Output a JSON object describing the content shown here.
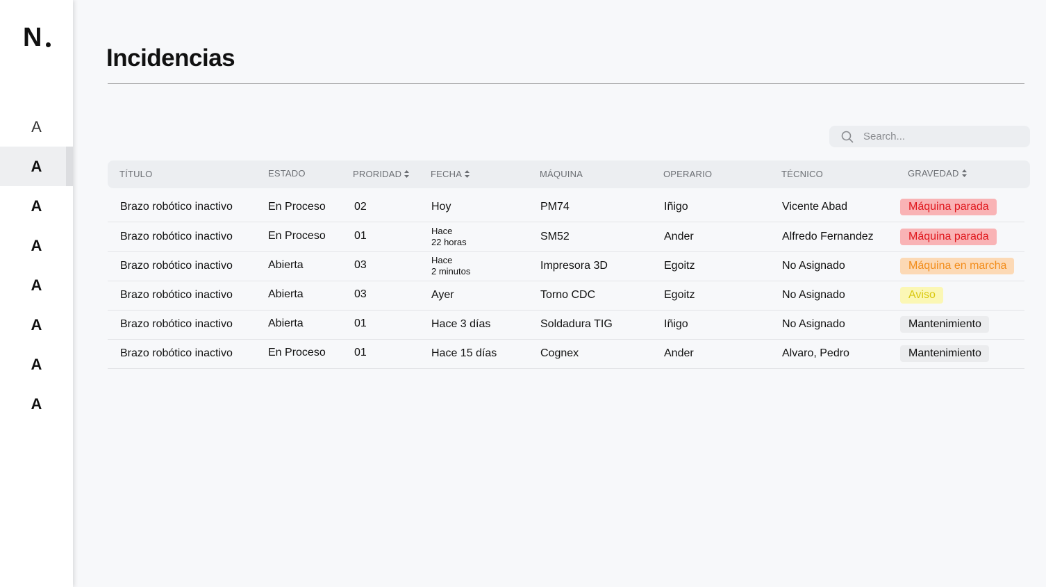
{
  "logo": {
    "text": "N"
  },
  "nav": {
    "items": [
      {
        "label": "A",
        "active": false,
        "style": "light"
      },
      {
        "label": "A",
        "active": true,
        "style": "bold"
      },
      {
        "label": "A",
        "active": false,
        "style": "bold"
      },
      {
        "label": "A",
        "active": false,
        "style": "bold"
      },
      {
        "label": "A",
        "active": false,
        "style": "bold"
      },
      {
        "label": "A",
        "active": false,
        "style": "bold"
      },
      {
        "label": "A",
        "active": false,
        "style": "bold"
      },
      {
        "label": "A",
        "active": false,
        "style": "bold"
      }
    ]
  },
  "page": {
    "title": "Incidencias"
  },
  "search": {
    "placeholder": "Search...",
    "value": "",
    "icon": "search-icon"
  },
  "table": {
    "headers": {
      "titulo": "TÍTULO",
      "estado": "ESTADO",
      "prioridad": "PRORIDAD",
      "fecha": "FECHA",
      "maquina": "MÁQUINA",
      "operario": "OPERARIO",
      "tecnico": "TÉCNICO",
      "gravedad": "GRAVEDAD"
    },
    "rows": [
      {
        "titulo": "Brazo robótico inactivo",
        "estado": "En Proceso",
        "prioridad": "02",
        "fecha": "Hoy",
        "fecha_line1": "",
        "fecha_line2": "",
        "maquina": "PM74",
        "operario": "Iñigo",
        "tecnico": "Vicente Abad",
        "gravedad": "Máquina parada",
        "gravedad_level": "red"
      },
      {
        "titulo": "Brazo robótico inactivo",
        "estado": "En Proceso",
        "prioridad": "01",
        "fecha": "",
        "fecha_line1": "Hace",
        "fecha_line2": "22 horas",
        "maquina": "SM52",
        "operario": "Ander",
        "tecnico": "Alfredo Fernandez",
        "gravedad": "Máquina parada",
        "gravedad_level": "red"
      },
      {
        "titulo": "Brazo robótico inactivo",
        "estado": "Abierta",
        "prioridad": "03",
        "fecha": "",
        "fecha_line1": "Hace",
        "fecha_line2": "2 minutos",
        "maquina": "Impresora 3D",
        "operario": "Egoitz",
        "tecnico": "No Asignado",
        "gravedad": "Máquina en marcha",
        "gravedad_level": "orange"
      },
      {
        "titulo": "Brazo robótico inactivo",
        "estado": "Abierta",
        "prioridad": "03",
        "fecha": "Ayer",
        "fecha_line1": "",
        "fecha_line2": "",
        "maquina": "Torno CDC",
        "operario": "Egoitz",
        "tecnico": "No Asignado",
        "gravedad": "Aviso",
        "gravedad_level": "yellow"
      },
      {
        "titulo": "Brazo robótico inactivo",
        "estado": "Abierta",
        "prioridad": "01",
        "fecha": "Hace 3 días",
        "fecha_line1": "",
        "fecha_line2": "",
        "maquina": "Soldadura TIG",
        "operario": "Iñigo",
        "tecnico": "No Asignado",
        "gravedad": "Mantenimiento",
        "gravedad_level": "grey"
      },
      {
        "titulo": "Brazo robótico inactivo",
        "estado": "En Proceso",
        "prioridad": "01",
        "fecha": "Hace 15 días",
        "fecha_line1": "",
        "fecha_line2": "",
        "maquina": "Cognex",
        "operario": "Ander",
        "tecnico": "Alvaro, Pedro",
        "gravedad": "Mantenimiento",
        "gravedad_level": "grey"
      }
    ]
  },
  "colors": {
    "badge_red_bg": "#f9b3b5",
    "badge_red_text": "#e0161c",
    "badge_orange_bg": "#fcd9b5",
    "badge_orange_text": "#f28c1a",
    "badge_yellow_bg": "#fbf7b5",
    "badge_yellow_text": "#d9c80f",
    "badge_grey_bg": "#ebecee"
  }
}
